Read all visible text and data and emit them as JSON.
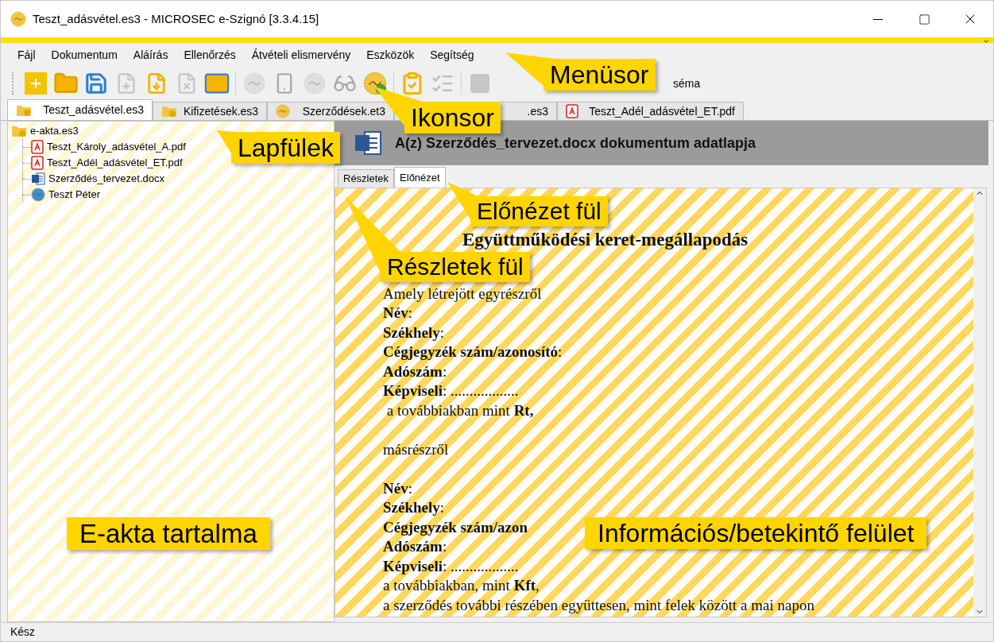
{
  "window": {
    "title": "Teszt_adásvétel.es3 - MICROSEC e-Szignó [3.3.4.15]"
  },
  "menu": [
    "Fájl",
    "Dokumentum",
    "Aláírás",
    "Ellenőrzés",
    "Átvételi elismervény",
    "Eszközök",
    "Segítség"
  ],
  "toolbar": {
    "buttons": [
      {
        "kind": "new",
        "disabled": false
      },
      {
        "kind": "open",
        "disabled": false
      },
      {
        "kind": "save",
        "disabled": false
      },
      {
        "kind": "add-file",
        "disabled": true
      },
      {
        "kind": "save-file",
        "disabled": false
      },
      {
        "kind": "remove-file",
        "disabled": true
      },
      {
        "kind": "mail",
        "disabled": false
      },
      {
        "kind": "separator"
      },
      {
        "kind": "seal",
        "disabled": true
      },
      {
        "kind": "mobile",
        "disabled": true
      },
      {
        "kind": "seals",
        "disabled": true
      },
      {
        "kind": "glasses",
        "disabled": true
      },
      {
        "kind": "verify",
        "disabled": false
      },
      {
        "kind": "separator"
      },
      {
        "kind": "checklist",
        "disabled": false
      },
      {
        "kind": "checklist",
        "disabled": true
      },
      {
        "kind": "separator"
      },
      {
        "kind": "blank",
        "disabled": true
      }
    ],
    "trailing_text": "séma"
  },
  "document_tabs": [
    {
      "label": "Teszt_adásvétel.es3",
      "kind": "folder",
      "selected": true
    },
    {
      "label": "Kifizetések.es3",
      "kind": "folder",
      "selected": false
    },
    {
      "label": "Szerződések.et3",
      "kind": "seal",
      "selected": false
    },
    {
      "label": ".es3",
      "selected": false
    },
    {
      "label": "Teszt_Adél_adásvétel_ET.pdf",
      "kind": "pdf",
      "selected": false
    }
  ],
  "tree": {
    "label": "e-akta.es3",
    "kind": "folder",
    "children": [
      {
        "label": "Teszt_Károly_adásvétel_A.pdf",
        "kind": "pdf"
      },
      {
        "label": "Teszt_Adél_adásvétel_ET.pdf",
        "kind": "pdf"
      },
      {
        "label": "Szerződés_tervezet.docx",
        "kind": "word"
      },
      {
        "label": "Teszt Péter",
        "kind": "signature"
      }
    ]
  },
  "details": {
    "title": "A(z) Szerződés_tervezet.docx dokumentum adatlapja",
    "tabs": [
      {
        "label": "Részletek",
        "selected": false
      },
      {
        "label": "Előnézet",
        "selected": true
      }
    ],
    "preview": {
      "heading": "Együttműködési keret-megállapodás",
      "lines": [
        {
          "text": "Amely létrejött egyrészről",
          "space_before": false
        },
        {
          "text": "**Név**:",
          "space_before": false
        },
        {
          "text": "**Székhely**:",
          "space_before": false
        },
        {
          "text": "**Cégjegyzék szám/azonosító**:",
          "space_before": false
        },
        {
          "text": "**Adószám**:",
          "space_before": false
        },
        {
          "text": "**Képviseli**: ..................",
          "space_before": false
        },
        {
          "text": " a továbbiakban mint **Rt,**",
          "space_before": false
        },
        {
          "text": "másrészről",
          "space_before": true
        },
        {
          "text": "**Név**:",
          "space_before": true
        },
        {
          "text": "**Székhely**:",
          "space_before": false
        },
        {
          "text": "**Cégjegyzék szám/azon**",
          "space_before": false
        },
        {
          "text": "**Adószám**:",
          "space_before": false
        },
        {
          "text": "**Képviseli**: ..................",
          "space_before": false
        },
        {
          "text": "a továbbiakban, mint **Kft**,",
          "space_before": false
        },
        {
          "text": "a szerződés további részében együttesen, mint felek között a mai napon",
          "space_before": false
        }
      ]
    }
  },
  "annotations": [
    "Menüsor",
    "Ikonsor",
    "Lapfülek",
    "Előnézet fül",
    "Részletek fül",
    "E-akta tartalma",
    "Információs/betekintő felület"
  ],
  "status_bar": "Kész"
}
